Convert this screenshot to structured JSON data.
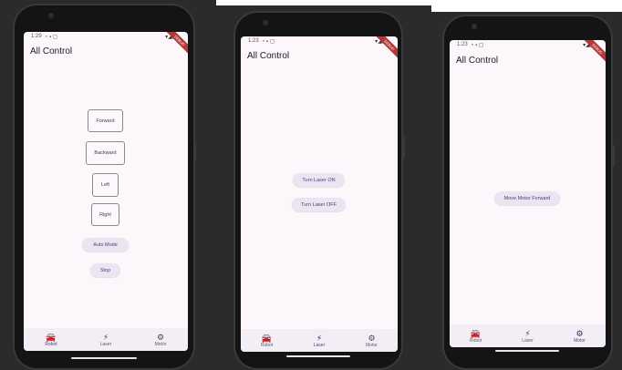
{
  "phones": [
    {
      "status": {
        "time": "1:29",
        "icons": "◔ ▪ ▢",
        "right": "▾◢▮"
      },
      "ribbon": "DEBUG",
      "title": "All Control",
      "controls": [
        "Forward",
        "Backward",
        "Left",
        "Right"
      ],
      "pills": [
        "Auto Mode",
        "Stop"
      ],
      "nav": [
        {
          "label": "Robot",
          "icon": "car-icon",
          "glyph": "🚘"
        },
        {
          "label": "Laser",
          "icon": "bolt-icon",
          "glyph": "⚡"
        },
        {
          "label": "Motor",
          "icon": "gear-icon",
          "glyph": "⚙"
        }
      ],
      "active_tab": "Robot"
    },
    {
      "status": {
        "time": "1:23",
        "icons": "◔ ▪ ▢",
        "right": "▾◢▮"
      },
      "ribbon": "DEBUG",
      "title": "All Control",
      "pills": [
        "Turn Laser ON",
        "Turn Laser OFF"
      ],
      "nav": [
        {
          "label": "Robot",
          "icon": "car-icon",
          "glyph": "🚘"
        },
        {
          "label": "Laser",
          "icon": "bolt-icon",
          "glyph": "⚡"
        },
        {
          "label": "Motor",
          "icon": "gear-icon",
          "glyph": "⚙"
        }
      ],
      "active_tab": "Laser"
    },
    {
      "status": {
        "time": "1:23",
        "icons": "◔ ▪ ▢",
        "right": "▾◢▮"
      },
      "ribbon": "DEBUG",
      "title": "All Control",
      "pills": [
        "Move Motor Forward"
      ],
      "nav": [
        {
          "label": "Robot",
          "icon": "car-icon",
          "glyph": "🚘"
        },
        {
          "label": "Laser",
          "icon": "bolt-icon",
          "glyph": "⚡"
        },
        {
          "label": "Motor",
          "icon": "gear-icon",
          "glyph": "⚙"
        }
      ],
      "active_tab": "Motor"
    }
  ],
  "colors": {
    "screen_bg": "#fdf7fc",
    "pill_bg": "#ece5f1",
    "accent": "#4a3f7a",
    "device": "#141414"
  }
}
